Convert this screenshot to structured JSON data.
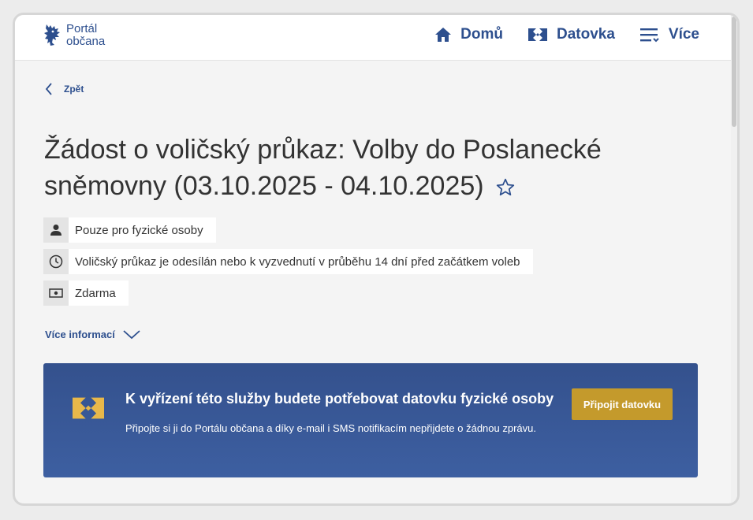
{
  "header": {
    "logo_line1": "Portál",
    "logo_line2": "občana",
    "nav": [
      {
        "label": "Domů",
        "icon": "home-icon"
      },
      {
        "label": "Datovka",
        "icon": "datovka-icon"
      },
      {
        "label": "Více",
        "icon": "menu-icon"
      }
    ]
  },
  "back_label": "Zpět",
  "title": "Žádost o voličský průkaz: Volby do Poslanecké sněmovny (03.10.2025 - 04.10.2025)",
  "info": [
    {
      "icon": "person-icon",
      "text": "Pouze pro fyzické osoby"
    },
    {
      "icon": "clock-icon",
      "text": "Voličský průkaz je odesílán nebo k vyzvednutí v průběhu 14 dní před začátkem voleb"
    },
    {
      "icon": "money-icon",
      "text": "Zdarma"
    }
  ],
  "more_label": "Více informací",
  "banner": {
    "title": "K vyřízení této služby budete potřebovat datovku fyzické osoby",
    "text": "Připojte si ji do Portálu občana a díky e-mail i SMS notifikacím nepřijdete o žádnou zprávu.",
    "button": "Připojit datovku"
  },
  "colors": {
    "brand": "#2d4f8e",
    "banner": "#3a5797",
    "button": "#c49a2c"
  }
}
